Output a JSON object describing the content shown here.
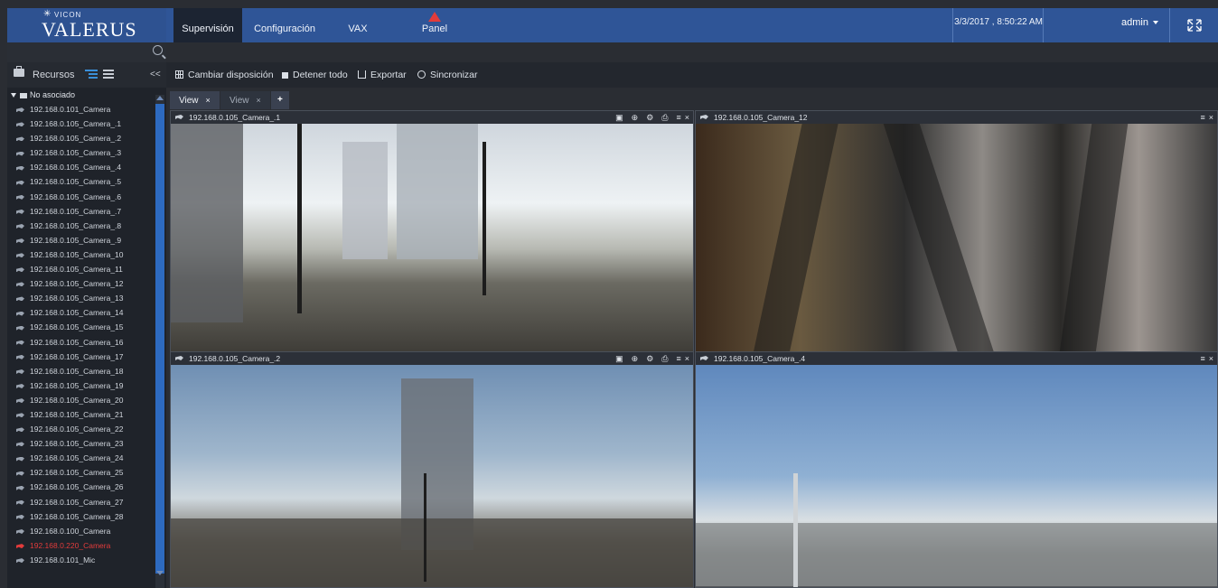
{
  "header": {
    "logo_small": "VICON",
    "logo_brand": "VALERUS",
    "tabs": [
      {
        "label": "Supervisión",
        "active": true
      },
      {
        "label": "Configuración",
        "active": false
      },
      {
        "label": "VAX",
        "active": false
      },
      {
        "label": "Panel",
        "active": false,
        "alert": true
      }
    ],
    "datetime": "3/3/2017 , 8:50:22 AM",
    "user": "admin",
    "accent_color": "#2f5597"
  },
  "sidebar": {
    "resources_label": "Recursos",
    "collapse_label": "<<",
    "root_label": "No asociado",
    "items": [
      {
        "label": "192.168.0.101_Camera"
      },
      {
        "label": "192.168.0.105_Camera_.1"
      },
      {
        "label": "192.168.0.105_Camera_.2"
      },
      {
        "label": "192.168.0.105_Camera_.3"
      },
      {
        "label": "192.168.0.105_Camera_.4"
      },
      {
        "label": "192.168.0.105_Camera_.5"
      },
      {
        "label": "192.168.0.105_Camera_.6"
      },
      {
        "label": "192.168.0.105_Camera_.7"
      },
      {
        "label": "192.168.0.105_Camera_.8"
      },
      {
        "label": "192.168.0.105_Camera_.9"
      },
      {
        "label": "192.168.0.105_Camera_10"
      },
      {
        "label": "192.168.0.105_Camera_11"
      },
      {
        "label": "192.168.0.105_Camera_12"
      },
      {
        "label": "192.168.0.105_Camera_13"
      },
      {
        "label": "192.168.0.105_Camera_14"
      },
      {
        "label": "192.168.0.105_Camera_15"
      },
      {
        "label": "192.168.0.105_Camera_16"
      },
      {
        "label": "192.168.0.105_Camera_17"
      },
      {
        "label": "192.168.0.105_Camera_18"
      },
      {
        "label": "192.168.0.105_Camera_19"
      },
      {
        "label": "192.168.0.105_Camera_20"
      },
      {
        "label": "192.168.0.105_Camera_21"
      },
      {
        "label": "192.168.0.105_Camera_22"
      },
      {
        "label": "192.168.0.105_Camera_23"
      },
      {
        "label": "192.168.0.105_Camera_24"
      },
      {
        "label": "192.168.0.105_Camera_25"
      },
      {
        "label": "192.168.0.105_Camera_26"
      },
      {
        "label": "192.168.0.105_Camera_27"
      },
      {
        "label": "192.168.0.105_Camera_28"
      },
      {
        "label": "192.168.0.100_Camera"
      },
      {
        "label": "192.168.0.220_Camera",
        "status": "error"
      },
      {
        "label": "192.168.0.101_Mic"
      }
    ]
  },
  "toolbar": {
    "layout_label": "Cambiar disposición",
    "stop_label": "Detener todo",
    "export_label": "Exportar",
    "sync_label": "Sincronizar"
  },
  "view_tabs": [
    {
      "label": "View",
      "active": true
    },
    {
      "label": "View",
      "active": false
    }
  ],
  "panes": [
    {
      "title": "192.168.0.105_Camera_.1"
    },
    {
      "title": "192.168.0.105_Camera_12"
    },
    {
      "title": "192.168.0.105_Camera_.2"
    },
    {
      "title": "192.168.0.105_Camera_.4"
    }
  ],
  "pane_tool_glyphs": {
    "snapshot": "▣",
    "zoom": "⊕",
    "settings": "⚙",
    "export": "⎙",
    "menu": "≡",
    "close": "×"
  }
}
